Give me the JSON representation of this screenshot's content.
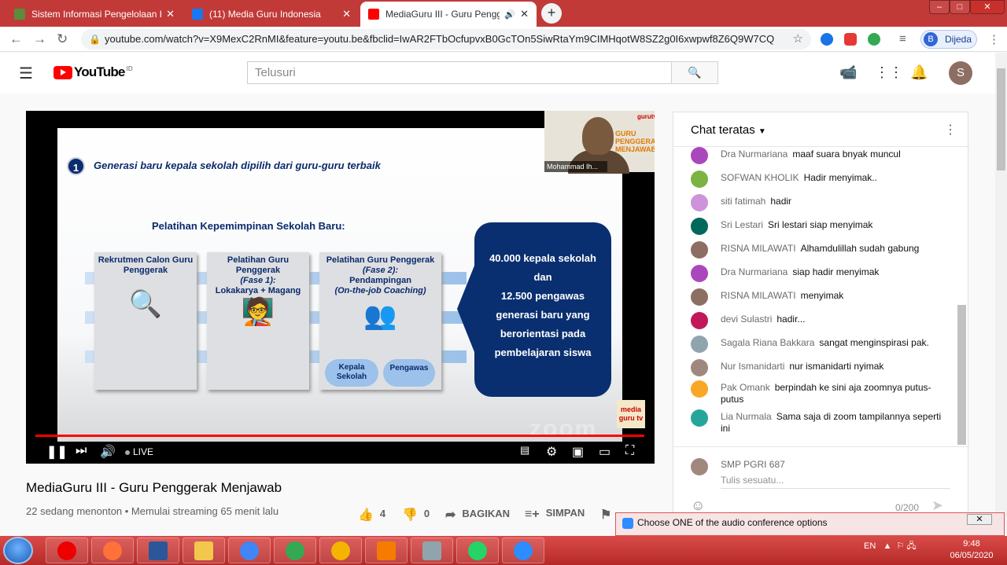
{
  "browser": {
    "tabs": [
      {
        "title": "Sistem Informasi Pengelolaan Ke",
        "favicon_color": "#5b8c3a",
        "active": false
      },
      {
        "title": "(11) Media Guru Indonesia",
        "favicon_color": "#1877f2",
        "active": false
      },
      {
        "title": "MediaGuru III - Guru Pengge",
        "favicon_color": "#ff0000",
        "active": true
      }
    ],
    "url": "youtube.com/watch?v=X9MexC2RnMI&feature=youtu.be&fbclid=IwAR2FTbOcfupvxB0GcTOn5SiwRtaYm9CIMHqotW8SZ2g0I6xwpwf8Z6Q9W7CQ",
    "profile_initial": "B",
    "profile_label": "Dijeda"
  },
  "youtube": {
    "logo_text": "YouTube",
    "logo_country": "ID",
    "search_placeholder": "Telusuri",
    "user_initial": "S"
  },
  "video": {
    "slide": {
      "number": "1",
      "headline": "Generasi baru kepala sekolah dipilih dari guru-guru terbaik",
      "section_title": "Pelatihan Kepemimpinan Sekolah Baru:",
      "box1": "Rekrutmen Calon Guru Penggerak",
      "box2_title": "Pelatihan Guru Penggerak",
      "box2_phase": "(Fase 1):",
      "box2_detail": "Lokakarya + Magang",
      "box3_title": "Pelatihan Guru Penggerak",
      "box3_phase": "(Fase 2):",
      "box3_detail": "Pendampingan",
      "box3_detail2": "(On-the-job Coaching)",
      "pill1": "Kepala Sekolah",
      "pill2": "Pengawas",
      "result_line1": "40.000 kepala sekolah",
      "result_line2": "dan",
      "result_line3": "12.500 pengawas",
      "result_line4": "generasi baru yang berorientasi pada pembelajaran siswa"
    },
    "pip_name": "Mohammad Ih...",
    "pip_text": "GURU PENGGERAK MENJAWAB",
    "pip_brand": "gurutv",
    "watermark": "zoom",
    "corner_logo": "media guru tv",
    "live_label": "LIVE",
    "progress_fraction": 1.0,
    "title": "MediaGuru III - Guru Penggerak Menjawab",
    "meta": "22 sedang menonton • Memulai streaming 65 menit lalu",
    "likes": "4",
    "dislikes": "0",
    "share_label": "BAGIKAN",
    "save_label": "SIMPAN"
  },
  "chat": {
    "header": "Chat teratas",
    "messages": [
      {
        "author": "Dra Nurmariana",
        "text": "maaf suara bnyak muncul",
        "avatar_color": "#ab47bc"
      },
      {
        "author": "SOFWAN KHOLIK",
        "text": "Hadir menyimak..",
        "avatar_color": "#7cb342"
      },
      {
        "author": "siti fatimah",
        "text": "hadir",
        "avatar_color": "#ce93d8"
      },
      {
        "author": "Sri Lestari",
        "text": "Sri lestari siap menyimak",
        "avatar_color": "#00695c"
      },
      {
        "author": "RISNA MILAWATI",
        "text": "Alhamdulillah sudah gabung",
        "avatar_color": "#8d6e63"
      },
      {
        "author": "Dra Nurmariana",
        "text": "siap hadir menyimak",
        "avatar_color": "#ab47bc"
      },
      {
        "author": "RISNA MILAWATI",
        "text": "menyimak",
        "avatar_color": "#8d6e63"
      },
      {
        "author": "devi Sulastri",
        "text": "hadir...",
        "avatar_color": "#c2185b"
      },
      {
        "author": "Sagala Riana Bakkara",
        "text": "sangat menginspirasi pak.",
        "avatar_color": "#90a4ae"
      },
      {
        "author": "Nur Ismanidarti",
        "text": "nur ismanidarti nyimak",
        "avatar_color": "#a1887f"
      },
      {
        "author": "Pak Omank",
        "text": "berpindah ke sini aja zoomnya putus-putus",
        "avatar_color": "#f9a825"
      },
      {
        "author": "Lia Nurmala",
        "text": "Sama saja di zoom tampilannya seperti ini",
        "avatar_color": "#26a69a"
      }
    ],
    "input_channel": "SMP PGRI 687",
    "input_placeholder": "Tulis sesuatu...",
    "char_count": "0/200"
  },
  "popup": {
    "text": "Choose ONE of the audio conference options"
  },
  "taskbar": {
    "lang": "EN",
    "time": "9:48",
    "date": "06/05/2020"
  }
}
